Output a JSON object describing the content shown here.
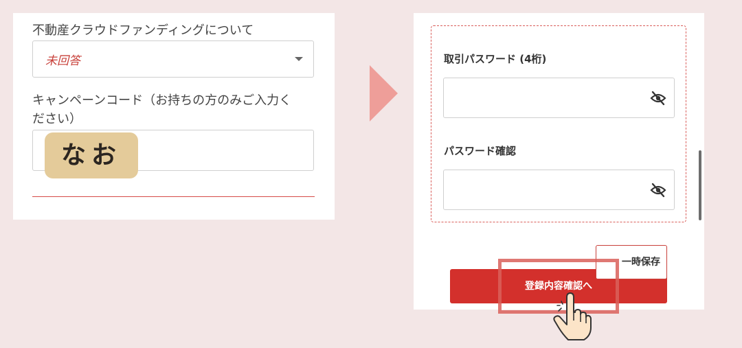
{
  "left_form": {
    "crowdfunding_label": "不動産クラウドファンディングについて",
    "crowdfunding_value": "未回答",
    "campaign_label_line1": "キャンペーンコード（お持ちの方のみご入力く",
    "campaign_label_line2": "ださい）",
    "campaign_sticker": "なお"
  },
  "right_form": {
    "trade_password_label": "取引パスワード (4桁)",
    "password_confirm_label": "パスワード確認",
    "save_button": "一時保存",
    "confirm_button": "登録内容確認へ",
    "visibility_icon": "eye-off-icon"
  },
  "colors": {
    "background": "#f3e6e6",
    "accent": "#d3302c",
    "arrow": "#ee9e99",
    "sticker": "#e4cb9a"
  }
}
